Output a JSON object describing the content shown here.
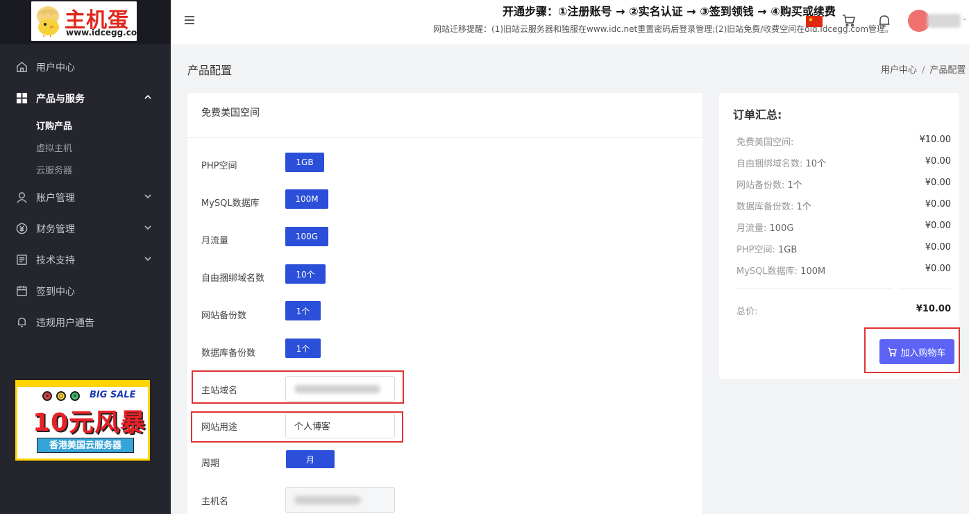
{
  "header": {
    "notice_title": "开通步骤：①注册账号 → ②实名认证 → ③签到领钱 → ④购买或续费",
    "notice_sub": "网站迁移提醒：(1)旧站云服务器和独服在www.idc.net重置密码后登录管理;(2)旧站免费/收费空间在old.idcegg.com管理。"
  },
  "logo": {
    "brand": "主机蛋",
    "url": "www.idcegg.com"
  },
  "sidebar": {
    "items": [
      {
        "label": "用户中心",
        "icon": "home-icon"
      },
      {
        "label": "产品与服务",
        "icon": "grid-icon"
      },
      {
        "label": "账户管理",
        "icon": "user-icon"
      },
      {
        "label": "财务管理",
        "icon": "finance-icon"
      },
      {
        "label": "技术支持",
        "icon": "support-icon"
      },
      {
        "label": "签到中心",
        "icon": "calendar-icon"
      },
      {
        "label": "违规用户通告",
        "icon": "bell-icon"
      }
    ],
    "subitems": [
      "订购产品",
      "虚拟主机",
      "云服务器"
    ]
  },
  "promo": {
    "dots": [
      "×",
      "○",
      "×"
    ],
    "big_sale": "BIG SALE",
    "headline": "10元风暴",
    "tagline": "香港美国云服务器"
  },
  "page": {
    "title": "产品配置",
    "breadcrumb": [
      "用户中心",
      "产品配置"
    ]
  },
  "product": {
    "name": "免费美国空间",
    "rows": [
      {
        "label": "PHP空间",
        "value": "1GB"
      },
      {
        "label": "MySQL数据库",
        "value": "100M"
      },
      {
        "label": "月流量",
        "value": "100G"
      },
      {
        "label": "自由捆绑域名数",
        "value": "10个"
      },
      {
        "label": "网站备份数",
        "value": "1个"
      },
      {
        "label": "数据库备份数",
        "value": "1个"
      }
    ],
    "domain_label": "主站域名",
    "purpose_label": "网站用途",
    "purpose_value": "个人博客",
    "period_label": "周期",
    "period_value": "月",
    "hostname_label": "主机名"
  },
  "summary": {
    "title": "订单汇总:",
    "rows": [
      {
        "label": "免费美国空间:",
        "qty": "",
        "price": "¥10.00"
      },
      {
        "label": "自由捆绑域名数:",
        "qty": "10个",
        "price": "¥0.00"
      },
      {
        "label": "网站备份数:",
        "qty": "1个",
        "price": "¥0.00"
      },
      {
        "label": "数据库备份数:",
        "qty": "1个",
        "price": "¥0.00"
      },
      {
        "label": "月流量:",
        "qty": "100G",
        "price": "¥0.00"
      },
      {
        "label": "PHP空间:",
        "qty": "1GB",
        "price": "¥0.00"
      },
      {
        "label": "MySQL数据库:",
        "qty": "100M",
        "price": "¥0.00"
      }
    ],
    "total_label": "总价:",
    "total_value": "¥10.00",
    "cart_button": "加入购物车"
  },
  "colors": {
    "primary": "#2b4fd9",
    "cart_button": "#5c63f5",
    "highlight": "#e03232",
    "sidebar": "#24252d"
  }
}
